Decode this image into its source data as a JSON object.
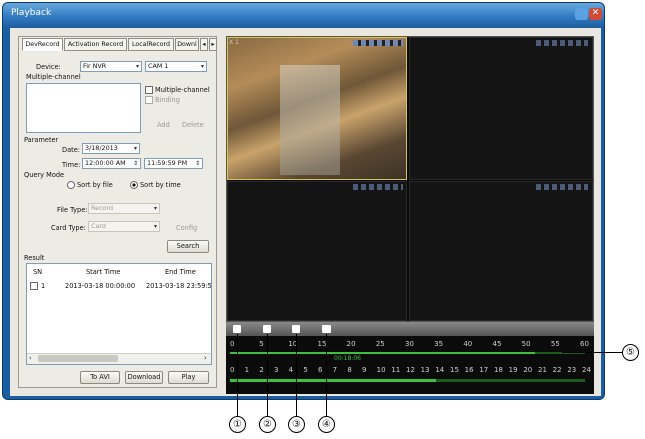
{
  "window": {
    "title": "Playback"
  },
  "tabs": [
    "DevRecord",
    "Activation Record",
    "LocalRecord",
    "Downl"
  ],
  "tab_scroll": "▸",
  "device": {
    "label": "Device:",
    "value": "Fir NVR",
    "cam_value": "CAM 1"
  },
  "multi_channel": {
    "label": "Multiple-channel",
    "checkbox_label": "Multiple-channel",
    "binding_label": "Binding",
    "add_label": "Add",
    "delete_label": "Delete"
  },
  "parameter": {
    "label": "Parameter",
    "date_label": "Date:",
    "date_value": "3/18/2013",
    "time_label": "Time:",
    "time_start": "12:00:00 AM",
    "time_end": "11:59:59 PM"
  },
  "query_mode": {
    "label": "Query Mode",
    "sort_by_file": "Sort by file",
    "sort_by_time": "Sort by time"
  },
  "file_type": {
    "label": "File Type:",
    "value": "Record"
  },
  "card_type": {
    "label": "Card Type:",
    "value": "Card",
    "config_label": "Config"
  },
  "search_label": "Search",
  "result": {
    "label": "Result",
    "columns": [
      "SN",
      "Start Time",
      "End Time"
    ],
    "rows": [
      {
        "sn": "1",
        "start": "2013-03-18 00:00:00",
        "end": "2013-03-18 23:59:59"
      }
    ]
  },
  "bottom_buttons": {
    "to_avi": "To AVI",
    "download": "Download",
    "play": "Play"
  },
  "video": {
    "cell1_label": "X 1"
  },
  "timeline": {
    "minute_ticks": [
      "0",
      "5",
      "10",
      "15",
      "20",
      "25",
      "30",
      "35",
      "40",
      "45",
      "50",
      "55",
      "60"
    ],
    "current_time": "00:18:06",
    "hour_ticks": [
      "0",
      "1",
      "2",
      "3",
      "4",
      "5",
      "6",
      "7",
      "8",
      "9",
      "10",
      "11",
      "12",
      "13",
      "14",
      "15",
      "16",
      "17",
      "18",
      "19",
      "20",
      "21",
      "22",
      "23",
      "24"
    ],
    "minute_progress": 0.86,
    "hour_progress": 0.58
  },
  "callouts": [
    "①",
    "②",
    "③",
    "④",
    "⑤"
  ],
  "colors": {
    "titlebar": "#2f78bf",
    "timeline_green": "#3fbf3f",
    "selected_border": "#d8c84a"
  }
}
